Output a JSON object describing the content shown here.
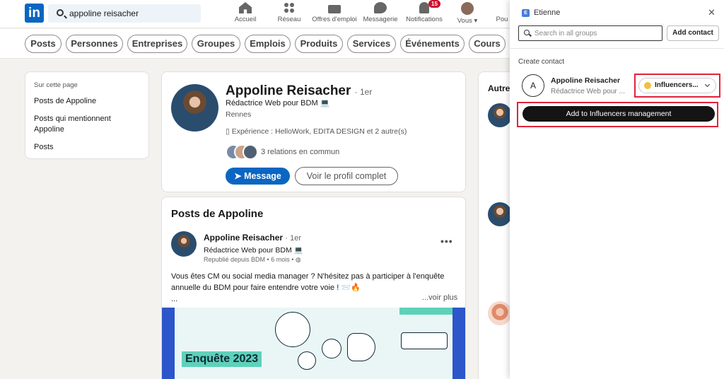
{
  "header": {
    "logo": "in",
    "search_value": "appoline reisacher",
    "nav": [
      {
        "label": "Accueil",
        "icon": "home-icon"
      },
      {
        "label": "Réseau",
        "icon": "network-icon"
      },
      {
        "label": "Offres d'emploi",
        "icon": "briefcase-icon"
      },
      {
        "label": "Messagerie",
        "icon": "message-icon"
      },
      {
        "label": "Notifications",
        "icon": "bell-icon",
        "badge": "15"
      },
      {
        "label": "Vous ▾",
        "icon": "avatar"
      },
      {
        "label": "Pou",
        "icon": "grid-icon"
      }
    ]
  },
  "filters": [
    "Posts",
    "Personnes",
    "Entreprises",
    "Groupes",
    "Emplois",
    "Produits",
    "Services",
    "Événements",
    "Cours"
  ],
  "on_this_page": {
    "title": "Sur cette page",
    "links": [
      "Posts de Appoline",
      "Posts qui mentionnent Appoline",
      "Posts"
    ]
  },
  "profile": {
    "name": "Appoline Reisacher",
    "degree": "· 1er",
    "headline": "Rédactrice Web pour BDM 💻",
    "location": "Rennes",
    "experience": "Expérience : HelloWork, EDITA DESIGN et 2 autre(s)",
    "mutual": "3 relations en commun",
    "message_btn": "Message",
    "view_btn": "Voir le profil complet"
  },
  "posts": {
    "title": "Posts de Appoline",
    "author": "Appoline Reisacher",
    "degree": "· 1er",
    "headline": "Rédactrice Web pour BDM 💻",
    "meta": "Republié depuis BDM • 6 mois •",
    "text": "Vous êtes CM ou social media manager ? N'hésitez pas à participer à l'enquête annuelle du BDM pour faire entendre votre voie ! 📨🔥",
    "ellipsis": "...",
    "more": "...voir plus",
    "image_label": "Enquête 2023"
  },
  "right_column": {
    "title": "Autre"
  },
  "extension": {
    "user": "Etienne",
    "search_placeholder": "Search in all groups",
    "add_contact": "Add contact",
    "create_contact": "Create contact",
    "contact_initial": "A",
    "contact_name": "Appoline Reisacher",
    "contact_headline": "Rédactrice Web pour ...",
    "group_select": "Influencers...",
    "cta": "Add to Influencers management",
    "highlight_color": "#e0243a"
  },
  "colors": {
    "linkedin_blue": "#0a66c2",
    "badge_red": "#cb112d",
    "cta_black": "#141414"
  }
}
